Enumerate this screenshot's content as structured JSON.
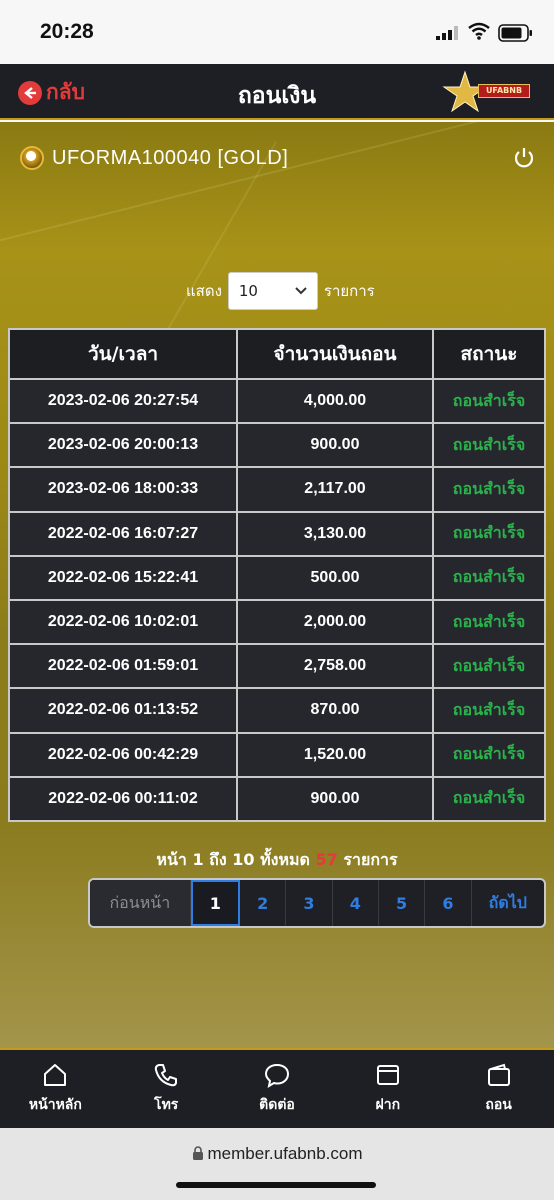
{
  "status_bar": {
    "time": "20:28"
  },
  "header": {
    "back_label": "กลับ",
    "title": "ถอนเงิน",
    "logo_text": "UFABNB"
  },
  "user": {
    "name": "UFORMA100040 [GOLD]"
  },
  "filter": {
    "show_label": "แสดง",
    "page_size": "10",
    "items_label": "รายการ"
  },
  "table": {
    "headers": [
      "วัน/เวลา",
      "จำนวนเงินถอน",
      "สถานะ"
    ],
    "rows": [
      {
        "datetime": "2023-02-06 20:27:54",
        "amount": "4,000.00",
        "status": "ถอนสำเร็จ"
      },
      {
        "datetime": "2023-02-06 20:00:13",
        "amount": "900.00",
        "status": "ถอนสำเร็จ"
      },
      {
        "datetime": "2023-02-06 18:00:33",
        "amount": "2,117.00",
        "status": "ถอนสำเร็จ"
      },
      {
        "datetime": "2022-02-06 16:07:27",
        "amount": "3,130.00",
        "status": "ถอนสำเร็จ"
      },
      {
        "datetime": "2022-02-06 15:22:41",
        "amount": "500.00",
        "status": "ถอนสำเร็จ"
      },
      {
        "datetime": "2022-02-06 10:02:01",
        "amount": "2,000.00",
        "status": "ถอนสำเร็จ"
      },
      {
        "datetime": "2022-02-06 01:59:01",
        "amount": "2,758.00",
        "status": "ถอนสำเร็จ"
      },
      {
        "datetime": "2022-02-06 01:13:52",
        "amount": "870.00",
        "status": "ถอนสำเร็จ"
      },
      {
        "datetime": "2022-02-06 00:42:29",
        "amount": "1,520.00",
        "status": "ถอนสำเร็จ"
      },
      {
        "datetime": "2022-02-06 00:11:02",
        "amount": "900.00",
        "status": "ถอนสำเร็จ"
      }
    ]
  },
  "summary": {
    "page_word": "หน้า",
    "from": "1",
    "to_word": "ถึง",
    "to": "10",
    "total_word": "ทั้งหมด",
    "total": "57",
    "items_word": "รายการ"
  },
  "pagination": {
    "prev_label": "ก่อนหน้า",
    "pages": [
      "1",
      "2",
      "3",
      "4",
      "5",
      "6"
    ],
    "current": "1",
    "next_label": "ถัดไป"
  },
  "bottom_nav": [
    {
      "label": "หน้าหลัก",
      "icon": "home-icon"
    },
    {
      "label": "โทร",
      "icon": "phone-icon"
    },
    {
      "label": "ติดต่อ",
      "icon": "chat-icon"
    },
    {
      "label": "ฝาก",
      "icon": "deposit-icon"
    },
    {
      "label": "ถอน",
      "icon": "wallet-icon"
    }
  ],
  "browser": {
    "url": "member.ufabnb.com"
  },
  "colors": {
    "accent_gold": "#c79b1a",
    "status_green": "#2bb24c",
    "back_red": "#e23b3b",
    "page_blue": "#2f7de1"
  }
}
